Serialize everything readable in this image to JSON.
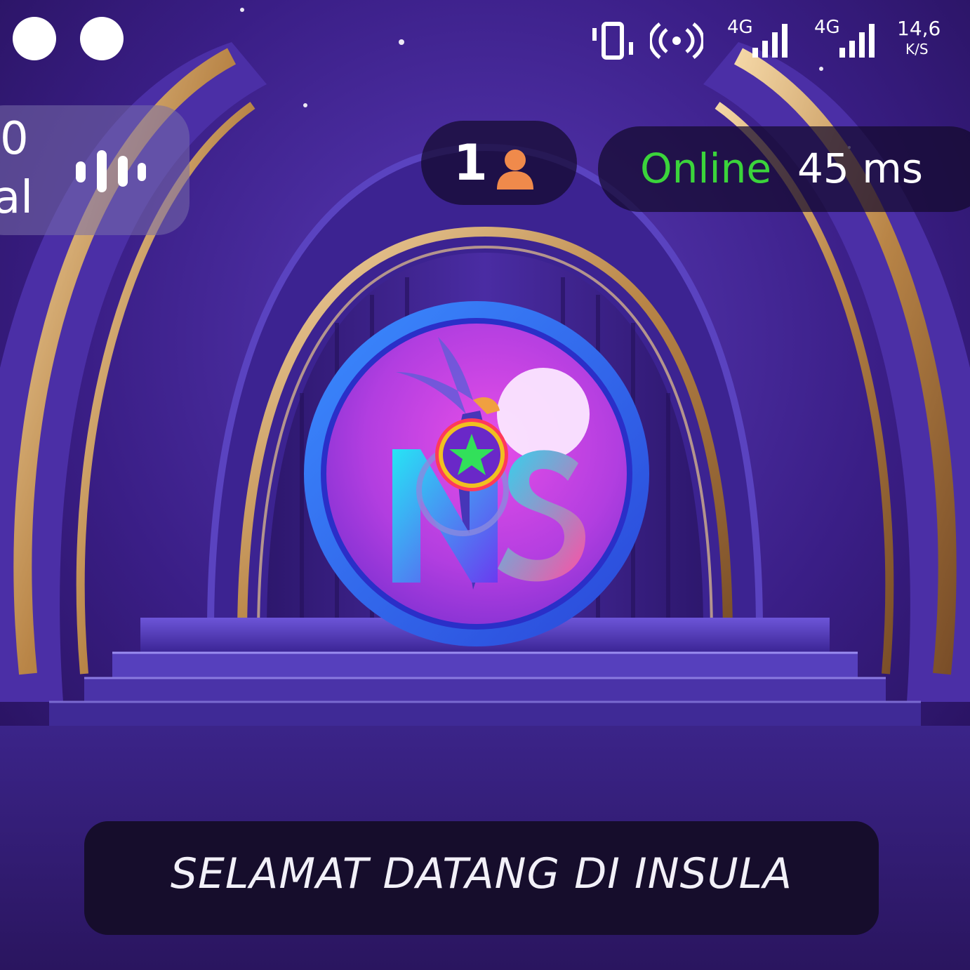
{
  "status_bar": {
    "network_type_1": "4G",
    "network_type_2": "4G",
    "speed_value": "14,6",
    "speed_unit": "K/S"
  },
  "stat_panel": {
    "line_1": "0",
    "line_2": "al"
  },
  "viewers": {
    "count": "1"
  },
  "connection": {
    "status": "Online",
    "ping": "45 ms"
  },
  "welcome": {
    "message": "SELAMAT DATANG DI INSULA"
  },
  "colors": {
    "online_green": "#3bd43b",
    "person_orange": "#f08a4b",
    "stage_purple": "#4a2a9a",
    "gold": "#c89a5a"
  },
  "icons": {
    "vibrate": "vibrate-icon",
    "hotspot": "hotspot-icon",
    "signal": "signal-bars-icon",
    "audio": "audio-bars-icon",
    "person": "person-icon",
    "logo": "ns-logo"
  }
}
